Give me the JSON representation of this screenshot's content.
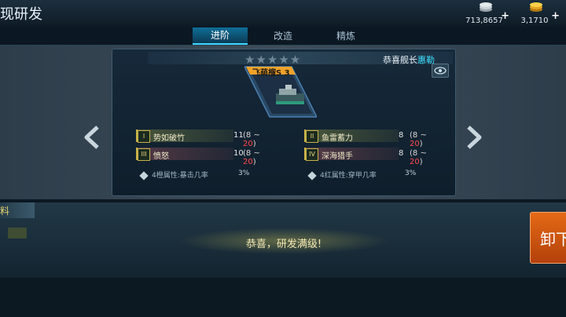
{
  "header": {
    "title": "现研发"
  },
  "currencies": [
    {
      "name": "silver",
      "value": "713,8657",
      "plus": "+"
    },
    {
      "name": "gold",
      "value": "3,1710",
      "plus": "+"
    }
  ],
  "tabs": [
    {
      "label": "进阶",
      "active": true
    },
    {
      "label": "改造",
      "active": false
    },
    {
      "label": "精炼",
      "active": false
    }
  ],
  "panel": {
    "stars": "★★★★★",
    "congrats_prefix": "恭喜舰长",
    "captain_name": "惠勒",
    "ship_name": "飞萌榴S 3",
    "stats": [
      {
        "icon": "I",
        "label": "势如破竹",
        "value": "11",
        "range_prefix": "(8 ~ ",
        "range_max": "20",
        "range_suffix": ")"
      },
      {
        "icon": "II",
        "label": "鱼雷蓄力",
        "value": "8",
        "range_prefix": "(8 ~ ",
        "range_max": "20",
        "range_suffix": ")"
      },
      {
        "icon": "III",
        "label": "愤怒",
        "value": "10",
        "range_prefix": "(8 ~ ",
        "range_max": "20",
        "range_suffix": ")"
      },
      {
        "icon": "IV",
        "label": "深海猎手",
        "value": "8",
        "range_prefix": "(8 ~ ",
        "range_max": "20",
        "range_suffix": ")"
      }
    ],
    "notes": [
      {
        "text": "4橙属性:暴击几率",
        "pct": "3%"
      },
      {
        "text": "4红属性:穿甲几率",
        "pct": "3%"
      }
    ]
  },
  "bottom": {
    "tab_label": "料",
    "message": "恭喜，研发满级!",
    "unload_label": "卸下"
  },
  "colors": {
    "accent": "#3fd6ff",
    "highlight_red": "#ff4b4b",
    "orange_button": "#e46a16"
  },
  "icons": [
    "silver-coins-icon",
    "gold-coins-icon",
    "eye-icon",
    "left-arrow-icon",
    "right-arrow-icon",
    "diamond-bullet-icon"
  ]
}
